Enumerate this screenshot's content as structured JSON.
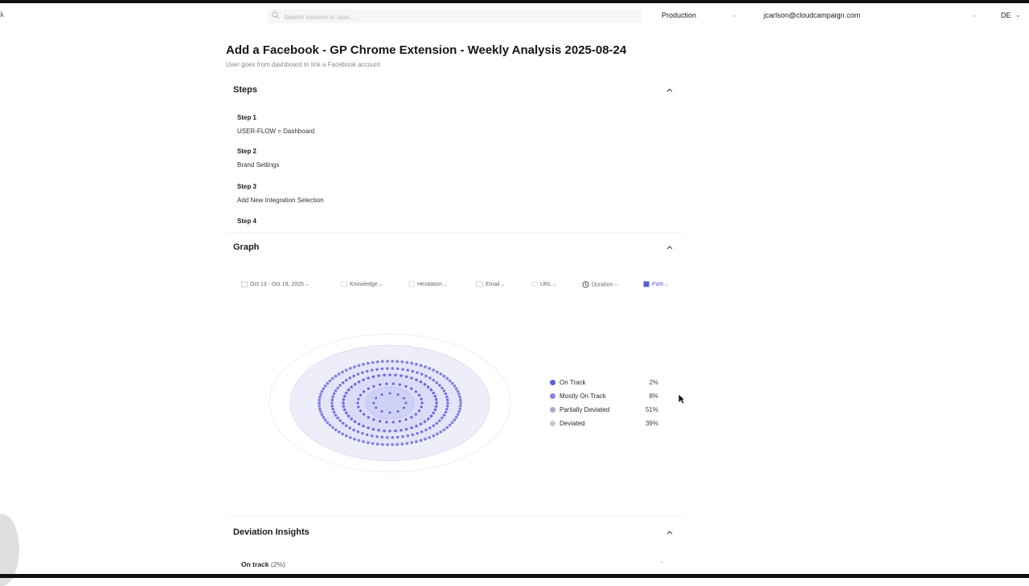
{
  "topbar": {
    "corner_glyph": "λ",
    "search_placeholder": "Search session or user...",
    "environment": "Production",
    "user_email": "jcarlson@cloudcampaign.com",
    "language": "DE"
  },
  "page": {
    "title": "Add a Facebook - GP Chrome Extension - Weekly Analysis 2025-08-24",
    "subtitle": "User goes from dashboard to link a Facebook account"
  },
  "steps_section": {
    "label": "Steps",
    "items": [
      {
        "label": "Step 1",
        "desc": "USER-FLOW = Dashboard"
      },
      {
        "label": "Step 2",
        "desc": "Brand Settings"
      },
      {
        "label": "Step 3",
        "desc": "Add New Integration Selection"
      },
      {
        "label": "Step 4",
        "desc": ""
      }
    ]
  },
  "graph_section": {
    "label": "Graph",
    "filters": [
      {
        "name": "date-range",
        "label": "Oct 13 - Oct 19, 2025",
        "icon": "calendar-icon"
      },
      {
        "name": "knowledge",
        "label": "Knowledge",
        "icon": "book-icon"
      },
      {
        "name": "hesitation",
        "label": "Hesitation",
        "icon": "pause-icon"
      },
      {
        "name": "email",
        "label": "Email",
        "icon": "mail-icon"
      },
      {
        "name": "url",
        "label": "URL",
        "icon": "link-icon"
      },
      {
        "name": "duration",
        "label": "Duration",
        "icon": "clock-icon"
      },
      {
        "name": "path",
        "label": "Path",
        "icon": "path-icon"
      }
    ],
    "legend": [
      {
        "name": "On Track",
        "pct": "2%",
        "color": "#5d5fd8"
      },
      {
        "name": "Mostly On Track",
        "pct": "8%",
        "color": "#8485e0"
      },
      {
        "name": "Partially Deviated",
        "pct": "51%",
        "color": "#a9aac4"
      },
      {
        "name": "Deviated",
        "pct": "39%",
        "color": "#c7c7d4"
      }
    ]
  },
  "deviation_section": {
    "label": "Deviation Insights",
    "on_track_label": "On track",
    "on_track_pct": "(2%)"
  }
}
